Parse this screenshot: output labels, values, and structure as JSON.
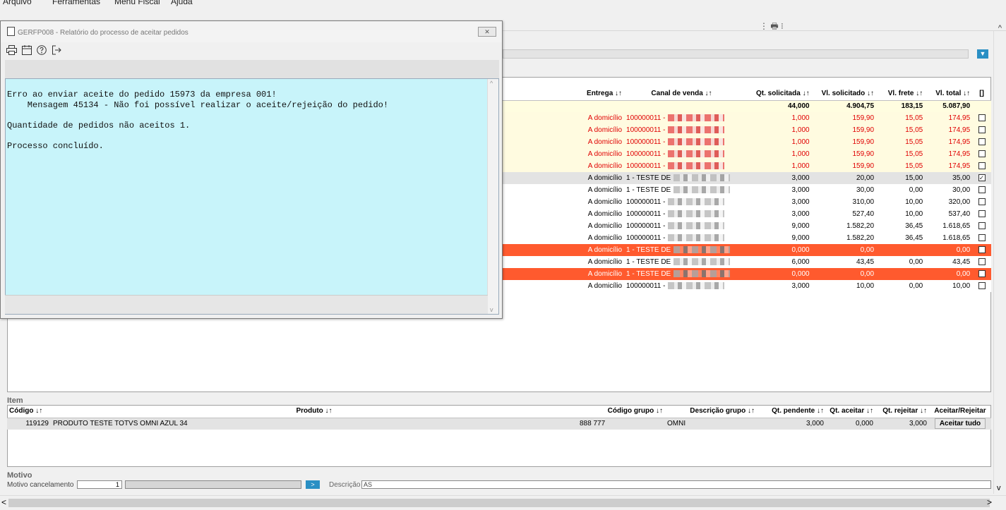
{
  "menu": [
    "Arquivo",
    "Ferramentas",
    "Menu Fiscal",
    "Ajuda"
  ],
  "icons": {
    "printer": "printer-icon",
    "calendar": "calendar-icon",
    "help": "help-icon",
    "exit": "exit-icon",
    "filter": "filter-icon"
  },
  "colors": {
    "error_text": "#e00000",
    "alert_row": "#ff5a2e",
    "highlight_row": "#fffbe0",
    "log_background": "#c8f4fa",
    "accent": "#2a8fc4"
  },
  "dialog": {
    "title": "GERFP008 - Relatório do processo de aceitar pedidos",
    "log_lines": [
      "Erro ao enviar aceite do pedido 15973 da empresa 001!",
      "    Mensagem 45134 - Não foi possível realizar o aceite/rejeição do pedido!",
      "",
      "Quantidade de pedidos não aceitos 1.",
      "",
      "Processo concluído."
    ]
  },
  "orders": {
    "columns": [
      "Entrega ↓↑",
      "Canal de venda ↓↑",
      "Qt. solicitada ↓↑",
      "Vl. solicitado ↓↑",
      "Vl. frete ↓↑",
      "Vl. total ↓↑",
      "[]"
    ],
    "totals": {
      "qt": "44,000",
      "vl_solicitado": "4.904,75",
      "frete": "183,15",
      "total": "5.087,90"
    },
    "rows": [
      {
        "entrega": "A domicílio",
        "canal": "100000011 -",
        "qt": "1,000",
        "vl": "159,90",
        "frete": "15,05",
        "total": "174,95",
        "checked": false,
        "style": "err"
      },
      {
        "entrega": "A domicílio",
        "canal": "100000011 -",
        "qt": "1,000",
        "vl": "159,90",
        "frete": "15,05",
        "total": "174,95",
        "checked": false,
        "style": "err"
      },
      {
        "entrega": "A domicílio",
        "canal": "100000011 -",
        "qt": "1,000",
        "vl": "159,90",
        "frete": "15,05",
        "total": "174,95",
        "checked": false,
        "style": "err"
      },
      {
        "entrega": "A domicílio",
        "canal": "100000011 -",
        "qt": "1,000",
        "vl": "159,90",
        "frete": "15,05",
        "total": "174,95",
        "checked": false,
        "style": "err"
      },
      {
        "entrega": "A domicílio",
        "canal": "100000011 -",
        "qt": "1,000",
        "vl": "159,90",
        "frete": "15,05",
        "total": "174,95",
        "checked": false,
        "style": "err"
      },
      {
        "entrega": "A domicílio",
        "canal": "1 - TESTE DE",
        "qt": "3,000",
        "vl": "20,00",
        "frete": "15,00",
        "total": "35,00",
        "checked": true,
        "style": "sel"
      },
      {
        "entrega": "A domicílio",
        "canal": "1 - TESTE DE",
        "qt": "3,000",
        "vl": "30,00",
        "frete": "0,00",
        "total": "30,00",
        "checked": false,
        "style": "plain"
      },
      {
        "entrega": "A domicílio",
        "canal": "100000011 -",
        "qt": "3,000",
        "vl": "310,00",
        "frete": "10,00",
        "total": "320,00",
        "checked": false,
        "style": "plain"
      },
      {
        "entrega": "A domicílio",
        "canal": "100000011 -",
        "qt": "3,000",
        "vl": "527,40",
        "frete": "10,00",
        "total": "537,40",
        "checked": false,
        "style": "plain"
      },
      {
        "entrega": "A domicílio",
        "canal": "100000011 -",
        "qt": "9,000",
        "vl": "1.582,20",
        "frete": "36,45",
        "total": "1.618,65",
        "checked": false,
        "style": "plain"
      },
      {
        "entrega": "A domicílio",
        "canal": "100000011 -",
        "qt": "9,000",
        "vl": "1.582,20",
        "frete": "36,45",
        "total": "1.618,65",
        "checked": false,
        "style": "plain"
      },
      {
        "entrega": "A domicílio",
        "canal": "1 - TESTE DE",
        "qt": "0,000",
        "vl": "0,00",
        "frete": "",
        "total": "0,00",
        "checked": false,
        "style": "alert"
      },
      {
        "entrega": "A domicílio",
        "canal": "1 - TESTE DE",
        "qt": "6,000",
        "vl": "43,45",
        "frete": "0,00",
        "total": "43,45",
        "checked": false,
        "style": "plain"
      },
      {
        "entrega": "A domicílio",
        "canal": "1 - TESTE DE",
        "qt": "0,000",
        "vl": "0,00",
        "frete": "",
        "total": "0,00",
        "checked": false,
        "style": "alert"
      },
      {
        "entrega": "A domicílio",
        "canal": "100000011 -",
        "qt": "3,000",
        "vl": "10,00",
        "frete": "0,00",
        "total": "10,00",
        "checked": false,
        "style": "plain"
      }
    ]
  },
  "item": {
    "section_label": "Item",
    "columns": [
      "Código ↓↑",
      "Produto ↓↑",
      "Código grupo ↓↑",
      "Descrição grupo ↓↑",
      "Qt. pendente ↓↑",
      "Qt. aceitar ↓↑",
      "Qt. rejeitar ↓↑",
      "Aceitar/Rejeitar"
    ],
    "rows": [
      {
        "codigo": "119129",
        "produto": "PRODUTO TESTE TOTVS OMNI AZUL 34",
        "codigo_grupo": "888 777",
        "descricao_grupo": "OMNI",
        "qt_pendente": "3,000",
        "qt_aceitar": "0,000",
        "qt_rejeitar": "3,000",
        "action": "Aceitar tudo"
      }
    ]
  },
  "motivo": {
    "section_label": "Motivo",
    "cancel_label": "Motivo cancelamento",
    "code": "1",
    "descricao_label": "Descrição",
    "descricao_value": "AS"
  }
}
